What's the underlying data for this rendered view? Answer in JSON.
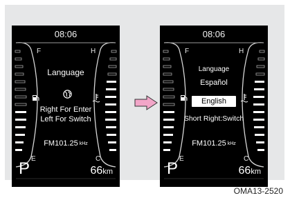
{
  "left_screen": {
    "time": "08:06",
    "fuel_full": "F",
    "fuel_empty": "E",
    "temp_hot": "H",
    "temp_cold": "C",
    "title": "Language",
    "hint_enter": "Right For Enter",
    "hint_switch": "Left For Switch",
    "radio_freq": "FM101.25",
    "radio_unit": "kHz",
    "gear": "P",
    "range_value": "66",
    "range_unit": "km"
  },
  "right_screen": {
    "time": "08:06",
    "fuel_full": "F",
    "fuel_empty": "E",
    "temp_hot": "H",
    "temp_cold": "C",
    "title": "Language",
    "option_spanish": "Español",
    "option_english": "English",
    "hint": "Short Right:Switch",
    "radio_freq": "FM101.25",
    "radio_unit": "kHz",
    "gear": "P",
    "range_value": "66",
    "range_unit": "km"
  },
  "icons": [
    "fuel-pump-icon",
    "coolant-temperature-icon",
    "globe-icon",
    "right-arrow-icon"
  ],
  "image_code": "OMA13-2520",
  "colors": {
    "arrow": "#f2a6c8",
    "screen": "#000000",
    "panel": "#e6e7e8"
  }
}
